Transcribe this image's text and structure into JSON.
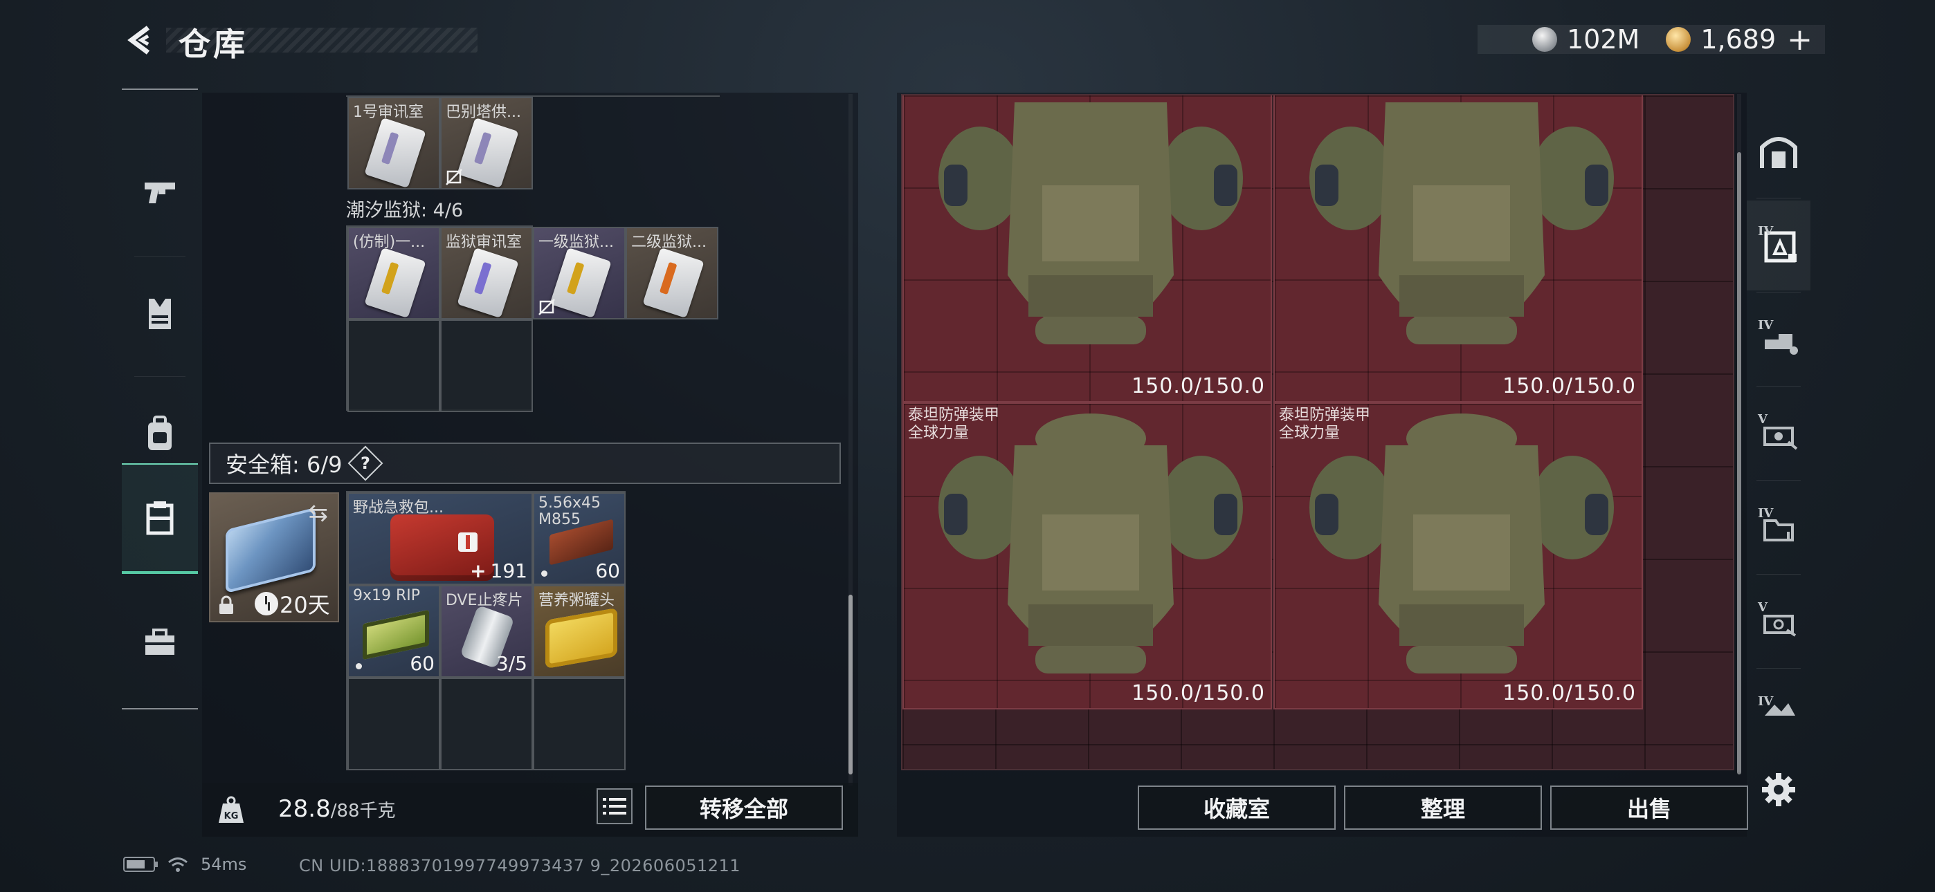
{
  "header": {
    "title": "仓库",
    "currency_silver": "102M",
    "currency_gold": "1,689",
    "plus_label": "+"
  },
  "left_nav": {
    "items": [
      {
        "name": "weapons",
        "icon": "pistol-icon"
      },
      {
        "name": "armor",
        "icon": "vest-icon"
      },
      {
        "name": "backpack",
        "icon": "backpack-icon"
      },
      {
        "name": "containers",
        "icon": "case-icon",
        "active": true
      },
      {
        "name": "tools",
        "icon": "toolbox-icon"
      }
    ]
  },
  "keycards_top": [
    {
      "label": "1号审讯室",
      "stripe": "#8d86b8"
    },
    {
      "label": "巴别塔供...",
      "stripe": "#8d86b8",
      "unusable": true
    }
  ],
  "chaoxi_section": {
    "title": "潮汐监狱: 4/6",
    "items": [
      {
        "label": "(仿制)一...",
        "stripe": "#d2a21b"
      },
      {
        "label": "监狱审讯室",
        "stripe": "#7a6fd0"
      },
      {
        "label": "一级监狱...",
        "stripe": "#d2a21b",
        "unusable": true
      },
      {
        "label": "二级监狱...",
        "stripe": "#d96a1e"
      }
    ]
  },
  "safebox": {
    "title": "安全箱: 6/9",
    "help_label": "?",
    "days_left": "20天",
    "items": [
      {
        "label": "野战急救包...",
        "count": "191",
        "prefix": "+"
      },
      {
        "label": "5.56x45 M855",
        "count": "60"
      },
      {
        "label": "9x19 RIP",
        "count": "60"
      },
      {
        "label": "DVE止疼片",
        "count": "3/5"
      },
      {
        "label": "营养粥罐头",
        "count": ""
      }
    ]
  },
  "footer_left": {
    "weight_value": "28.8",
    "weight_max": "/88千克",
    "transfer_all": "转移全部"
  },
  "stash": {
    "armors": [
      {
        "name": "",
        "durability": "150.0/150.0"
      },
      {
        "name": "",
        "durability": "150.0/150.0"
      },
      {
        "name": "泰坦防弹装甲\n全球力量",
        "durability": "150.0/150.0"
      },
      {
        "name": "泰坦防弹装甲\n全球力量",
        "durability": "150.0/150.0"
      }
    ],
    "buttons": {
      "collection": "收藏室",
      "sort": "整理",
      "sell": "出售"
    }
  },
  "stash_tabs": [
    {
      "roman": "",
      "icon": "vault-icon"
    },
    {
      "roman": "IV",
      "icon": "stash-ammo-icon",
      "active": true
    },
    {
      "roman": "IV",
      "icon": "stash-weapon-icon"
    },
    {
      "roman": "V",
      "icon": "stash-key-icon"
    },
    {
      "roman": "IV",
      "icon": "stash-folder-icon"
    },
    {
      "roman": "V",
      "icon": "stash-gear-icon"
    },
    {
      "roman": "IV",
      "icon": "stash-misc-icon"
    }
  ],
  "status_bar": {
    "ping": "54ms",
    "uid": "CN UID:18883701997749973437 9_202606051211"
  },
  "colors": {
    "accent_active": "#56c9a4",
    "stash_bg": "#62272f",
    "text_primary": "#e6e8ea"
  }
}
